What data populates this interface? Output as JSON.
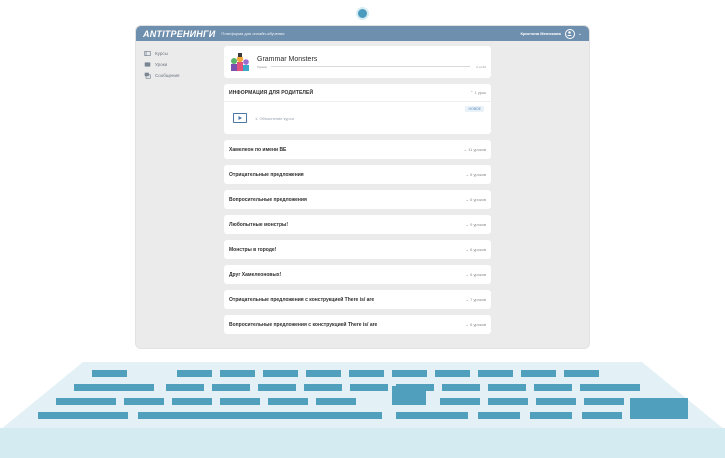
{
  "colors": {
    "topbar": "#6f8fae",
    "accent": "#4a77a8",
    "keyboard_base": "#d4ebf2",
    "key": "#4f9fbd"
  },
  "header": {
    "logo": "ANTITРЕНИНГИ",
    "tagline": "Платформа для онлайн-обучения",
    "user_name": "Кристина Мелюкова",
    "avatar_icon": "user-circle-icon"
  },
  "sidebar": {
    "items": [
      {
        "label": "Курсы",
        "icon": "courses-icon"
      },
      {
        "label": "Уроки",
        "icon": "lessons-icon"
      },
      {
        "label": "Сообщения",
        "icon": "messages-icon"
      }
    ]
  },
  "course": {
    "title": "Grammar Monsters",
    "progress_label": "Уроков",
    "progress_count": "0 из 60",
    "progress_fraction": 0
  },
  "open_section": {
    "title": "ИНФОРМАЦИЯ ДЛЯ РОДИТЕЛЕЙ",
    "meta": "1 урок",
    "lesson": "1. Объяснение курса",
    "badge": "НОВОЕ"
  },
  "sections": [
    {
      "title": "Хамелеон по имени BE",
      "meta": "11 уроков"
    },
    {
      "title": "Отрицательные предложения",
      "meta": "6 уроков"
    },
    {
      "title": "Вопросительные предложения",
      "meta": "6 уроков"
    },
    {
      "title": "Любопытные монстры!",
      "meta": "9 уроков"
    },
    {
      "title": "Монстры в городе!",
      "meta": "6 уроков"
    },
    {
      "title": "Друг Хамелеоновых!",
      "meta": "6 уроков"
    },
    {
      "title": "Отрицательные предложения с конструкцией There is/ are",
      "meta": "7 уроков"
    },
    {
      "title": "Вопросительные предложения с конструкцией There is/ are",
      "meta": "6 уроков"
    }
  ]
}
